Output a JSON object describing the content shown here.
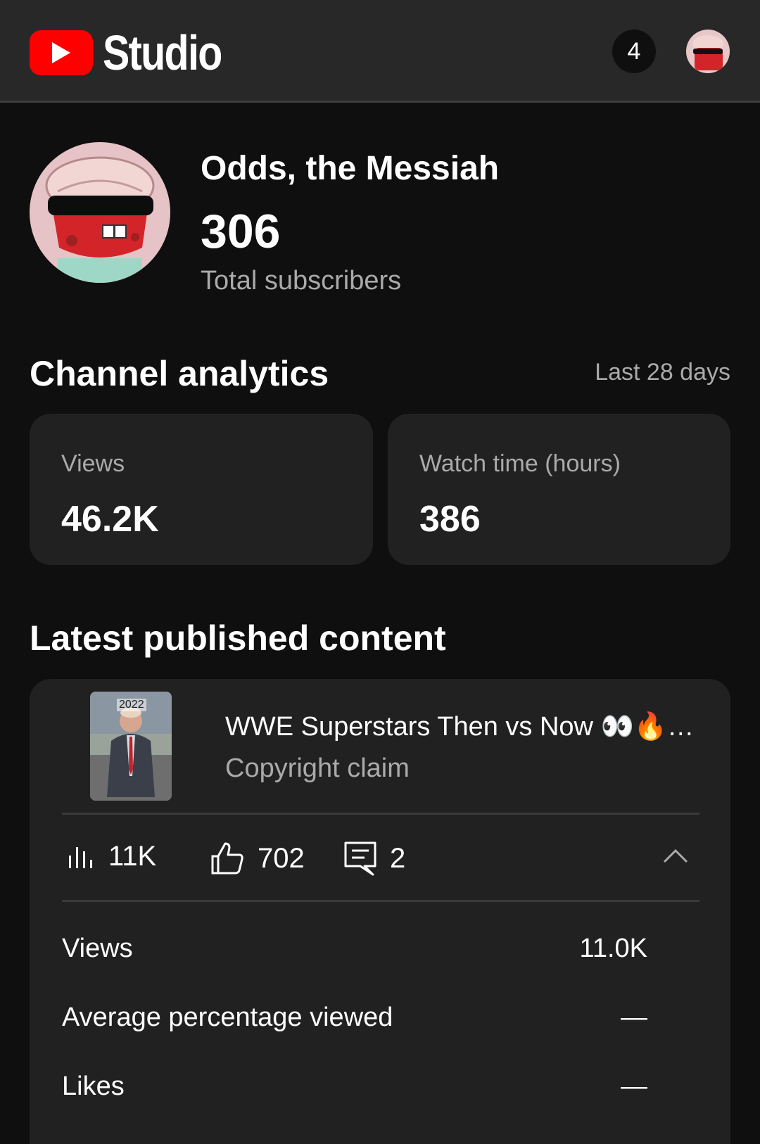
{
  "app": {
    "title": "Studio",
    "notification_count": "4",
    "brand_color": "#ff0000"
  },
  "channel": {
    "name": "Odds, the Messiah",
    "subscriber_count": "306",
    "subscriber_label": "Total subscribers"
  },
  "analytics": {
    "title": "Channel analytics",
    "range": "Last 28 days",
    "cards": [
      {
        "label": "Views",
        "value": "46.2K"
      },
      {
        "label": "Watch time (hours)",
        "value": "386"
      }
    ]
  },
  "latest": {
    "title": "Latest published content",
    "video": {
      "thumbnail_text": "2022",
      "title": "WWE Superstars Then vs Now 👀🔥…",
      "status": "Copyright claim",
      "views_short": "11K",
      "likes_short": "702",
      "comments_short": "2"
    },
    "metrics": [
      {
        "label": "Views",
        "value": "11.0K"
      },
      {
        "label": "Average percentage viewed",
        "value": "—"
      },
      {
        "label": "Likes",
        "value": "—"
      }
    ]
  }
}
